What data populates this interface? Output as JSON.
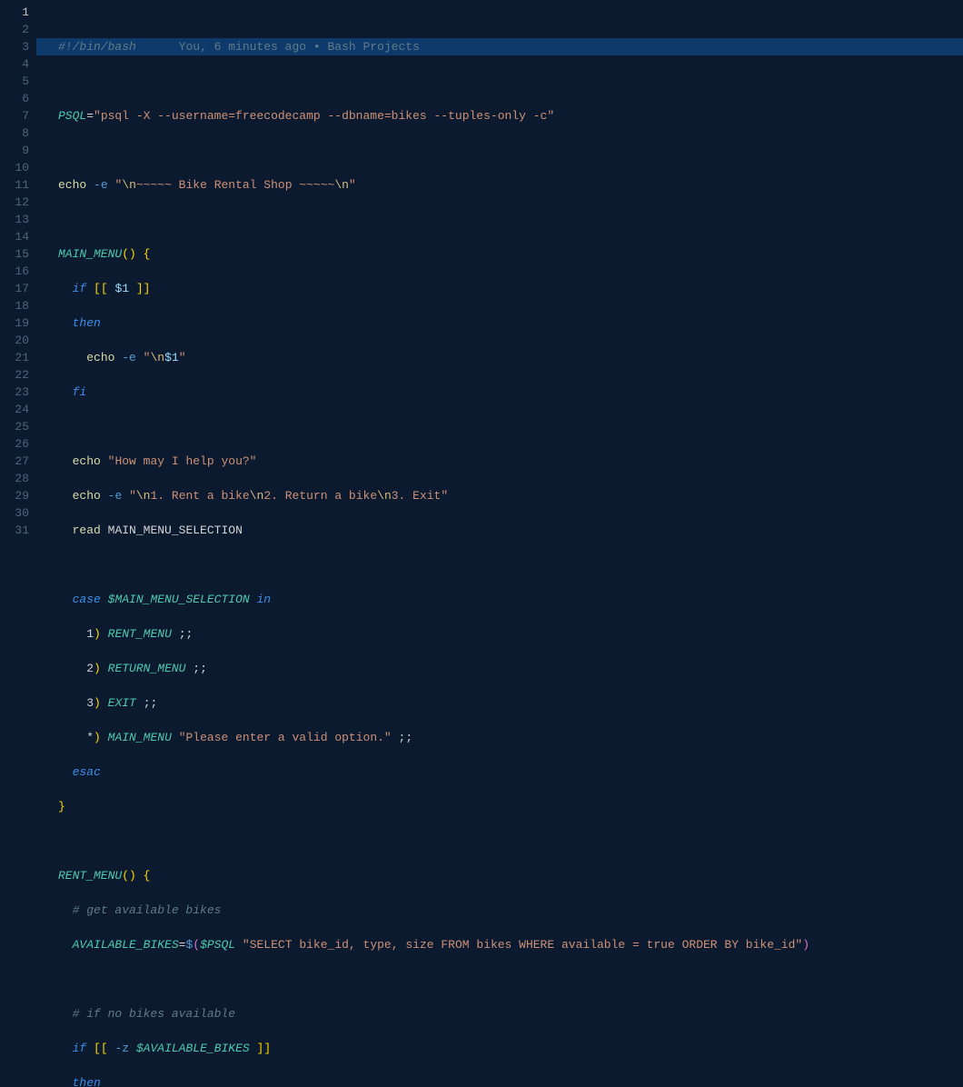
{
  "codelens": "You, 6 minutes ago • Bash Projects",
  "lines": {
    "l1_shebang": "#!/bin/bash",
    "l3_var": "PSQL",
    "l3_str": "\"psql -X --username=freecodecamp --dbname=bikes --tuples-only -c\"",
    "l5_echo": "echo",
    "l5_flag": "-e",
    "l5_s1": "\"",
    "l5_e1": "\\n",
    "l5_mid": "~~~~~ Bike Rental Shop ~~~~~",
    "l5_e2": "\\n",
    "l5_s2": "\"",
    "l7_fn": "MAIN_MENU",
    "l8_if": "if",
    "l8_v": "$1",
    "l9_then": "then",
    "l10_echo": "echo",
    "l10_flag": "-e",
    "l10_s1": "\"",
    "l10_e": "\\n",
    "l10_var": "$1",
    "l10_s2": "\"",
    "l11_fi": "fi",
    "l13_echo": "echo",
    "l13_str": "\"How may I help you?\"",
    "l14_echo": "echo",
    "l14_flag": "-e",
    "l14_s1": "\"",
    "l14_e1": "\\n",
    "l14_t1": "1. Rent a bike",
    "l14_e2": "\\n",
    "l14_t2": "2. Return a bike",
    "l14_e3": "\\n",
    "l14_t3": "3. Exit",
    "l14_s2": "\"",
    "l15_read": "read",
    "l15_var": "MAIN_MENU_SELECTION",
    "l17_case": "case",
    "l17_var": "$MAIN_MENU_SELECTION",
    "l17_in": "in",
    "l18_n": "1",
    "l18_fn": "RENT_MENU",
    "l19_n": "2",
    "l19_fn": "RETURN_MENU",
    "l20_n": "3",
    "l20_fn": "EXIT",
    "l21_star": "*",
    "l21_fn": "MAIN_MENU",
    "l21_str": "\"Please enter a valid option.\"",
    "l22_esac": "esac",
    "l25_fn": "RENT_MENU",
    "l26_c": "# get available bikes",
    "l27_var": "AVAILABLE_BIKES",
    "l27_psql": "$PSQL",
    "l27_str": "\"SELECT bike_id, type, size FROM bikes WHERE available = true ORDER BY bike_id\"",
    "l29_c": "# if no bikes available",
    "l30_if": "if",
    "l30_flag": "-z",
    "l30_var": "$AVAILABLE_BIKES",
    "l31_then": "then"
  },
  "line_count": 31
}
